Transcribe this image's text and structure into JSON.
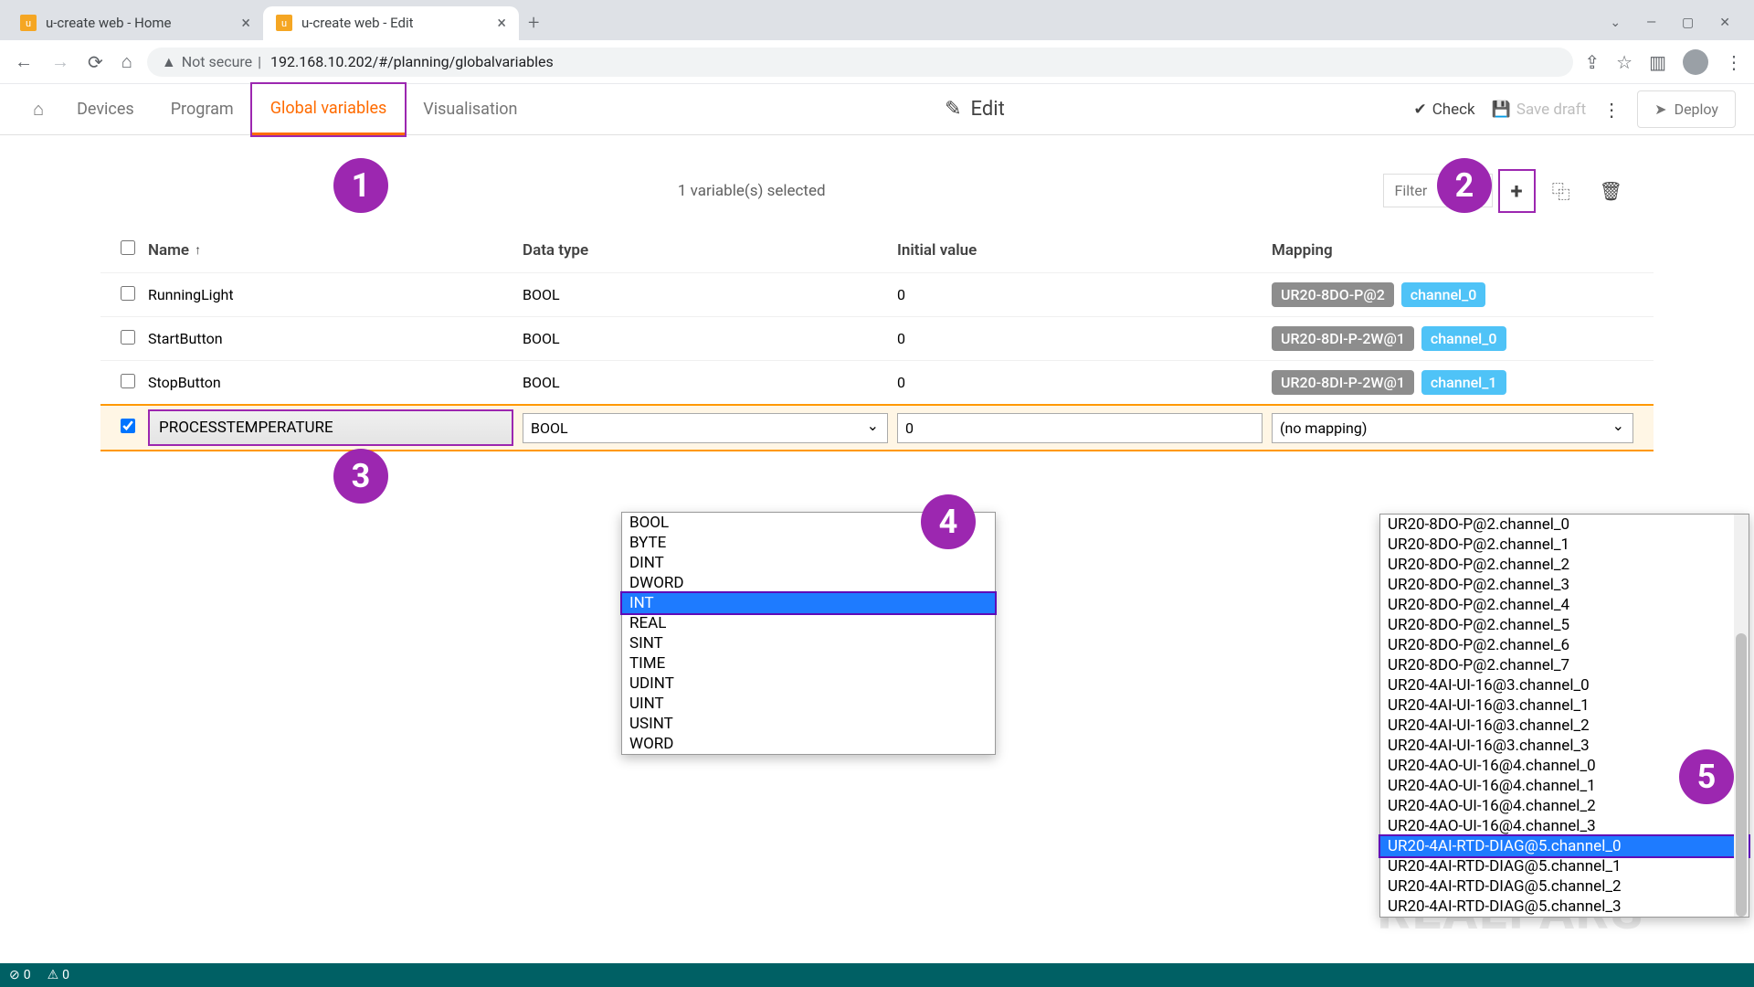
{
  "browser": {
    "tabs": [
      {
        "title": "u-create web - Home"
      },
      {
        "title": "u-create web - Edit"
      }
    ],
    "url_warning": "Not secure",
    "url": "192.168.10.202/#/planning/globalvariables"
  },
  "nav": {
    "items": [
      "Devices",
      "Program",
      "Global variables",
      "Visualisation"
    ],
    "active_index": 2,
    "center_label": "Edit",
    "check_label": "Check",
    "save_label": "Save draft",
    "deploy_label": "Deploy"
  },
  "toolbar": {
    "selection_text": "1 variable(s) selected",
    "filter_placeholder": "Filter"
  },
  "table": {
    "headers": {
      "name": "Name",
      "type": "Data type",
      "init": "Initial value",
      "map": "Mapping"
    },
    "rows": [
      {
        "name": "RunningLight",
        "type": "BOOL",
        "init": "0",
        "map_grey": "UR20-8DO-P@2",
        "map_blue": "channel_0"
      },
      {
        "name": "StartButton",
        "type": "BOOL",
        "init": "0",
        "map_grey": "UR20-8DI-P-2W@1",
        "map_blue": "channel_0"
      },
      {
        "name": "StopButton",
        "type": "BOOL",
        "init": "0",
        "map_grey": "UR20-8DI-P-2W@1",
        "map_blue": "channel_1"
      }
    ],
    "editing": {
      "name": "PROCESSTEMPERATURE",
      "type": "BOOL",
      "init": "0",
      "map": "(no mapping)"
    }
  },
  "type_options": [
    "BOOL",
    "BYTE",
    "DINT",
    "DWORD",
    "INT",
    "REAL",
    "SINT",
    "TIME",
    "UDINT",
    "UINT",
    "USINT",
    "WORD"
  ],
  "type_highlight_index": 4,
  "map_options": [
    "UR20-8DO-P@2.channel_0",
    "UR20-8DO-P@2.channel_1",
    "UR20-8DO-P@2.channel_2",
    "UR20-8DO-P@2.channel_3",
    "UR20-8DO-P@2.channel_4",
    "UR20-8DO-P@2.channel_5",
    "UR20-8DO-P@2.channel_6",
    "UR20-8DO-P@2.channel_7",
    "UR20-4AI-UI-16@3.channel_0",
    "UR20-4AI-UI-16@3.channel_1",
    "UR20-4AI-UI-16@3.channel_2",
    "UR20-4AI-UI-16@3.channel_3",
    "UR20-4AO-UI-16@4.channel_0",
    "UR20-4AO-UI-16@4.channel_1",
    "UR20-4AO-UI-16@4.channel_2",
    "UR20-4AO-UI-16@4.channel_3",
    "UR20-4AI-RTD-DIAG@5.channel_0",
    "UR20-4AI-RTD-DIAG@5.channel_1",
    "UR20-4AI-RTD-DIAG@5.channel_2",
    "UR20-4AI-RTD-DIAG@5.channel_3"
  ],
  "map_highlight_index": 16,
  "badges": [
    "1",
    "2",
    "3",
    "4",
    "5"
  ],
  "footer": {
    "errors": "0",
    "warnings": "0"
  },
  "watermark": "REALPARS"
}
